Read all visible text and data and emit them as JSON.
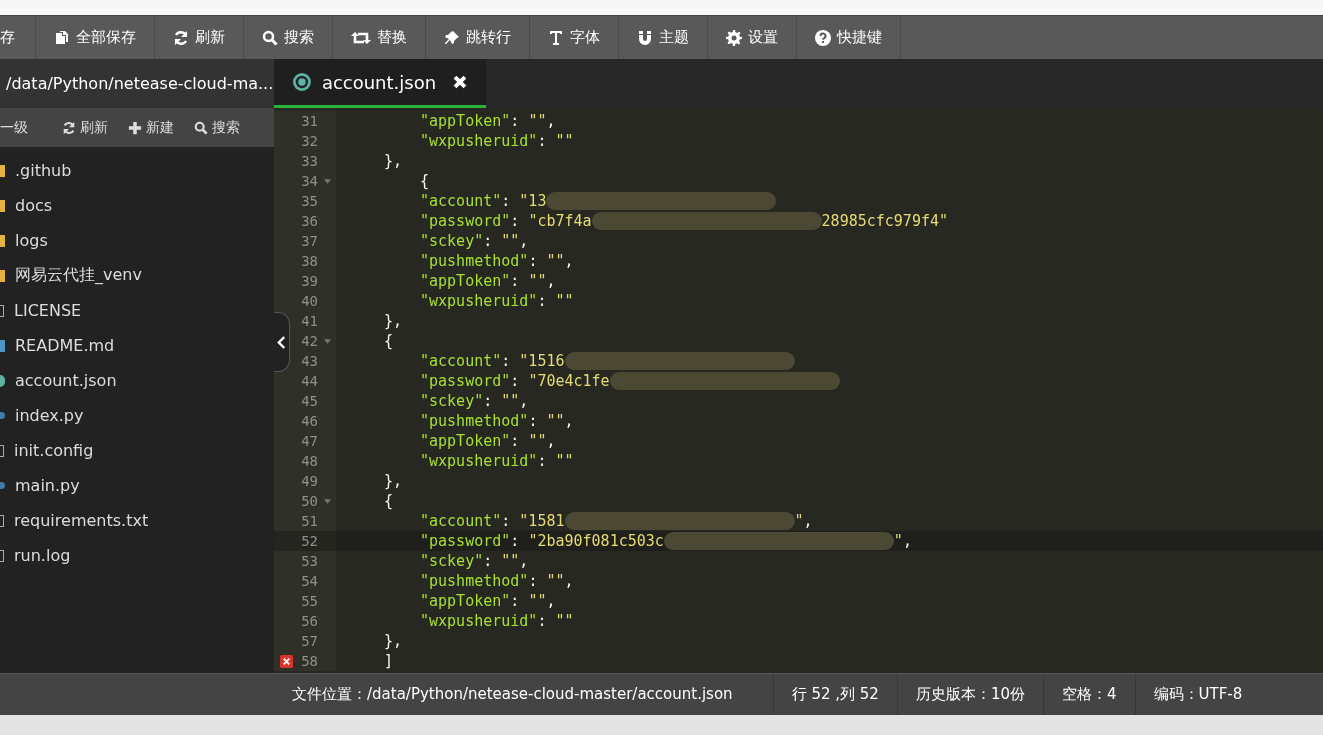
{
  "toolbar": [
    {
      "label": "存"
    },
    {
      "label": "全部保存"
    },
    {
      "label": "刷新"
    },
    {
      "label": "搜索"
    },
    {
      "label": "替换"
    },
    {
      "label": "跳转行"
    },
    {
      "label": "字体"
    },
    {
      "label": "主题"
    },
    {
      "label": "设置"
    },
    {
      "label": "快捷键"
    }
  ],
  "sidebar": {
    "path": "/data/Python/netease-cloud-ma...",
    "actions": [
      {
        "label": "一级"
      },
      {
        "label": "刷新"
      },
      {
        "label": "新建"
      },
      {
        "label": "搜索"
      }
    ],
    "items": [
      {
        "kind": "folder",
        "name": ".github"
      },
      {
        "kind": "folder",
        "name": "docs"
      },
      {
        "kind": "folder",
        "name": "logs"
      },
      {
        "kind": "folder",
        "name": "网易云代挂_venv"
      },
      {
        "kind": "file",
        "name": "LICENSE"
      },
      {
        "kind": "markdown",
        "name": "README.md"
      },
      {
        "kind": "json",
        "name": "account.json"
      },
      {
        "kind": "python",
        "name": "index.py"
      },
      {
        "kind": "file",
        "name": "init.config"
      },
      {
        "kind": "python",
        "name": "main.py"
      },
      {
        "kind": "file",
        "name": "requirements.txt"
      },
      {
        "kind": "file",
        "name": "run.log"
      }
    ]
  },
  "tabs": [
    {
      "label": "account.json",
      "selected": true
    }
  ],
  "editor": {
    "lines": [
      {
        "number": "31",
        "kind": "inner",
        "fold": false,
        "active": false,
        "error": false,
        "segments": [
          {
            "kind": "key",
            "text": "\"appToken\""
          },
          {
            "kind": "punct",
            "text": ": "
          },
          {
            "kind": "str",
            "text": "\"\""
          },
          {
            "kind": "punct",
            "text": ","
          }
        ]
      },
      {
        "number": "32",
        "kind": "inner",
        "fold": false,
        "active": false,
        "error": false,
        "segments": [
          {
            "kind": "key",
            "text": "\"wxpusheruid\""
          },
          {
            "kind": "punct",
            "text": ": "
          },
          {
            "kind": "str",
            "text": "\"\""
          }
        ]
      },
      {
        "number": "33",
        "kind": "outer",
        "fold": false,
        "active": false,
        "error": false,
        "segments": [
          {
            "kind": "punct",
            "text": "},"
          }
        ]
      },
      {
        "number": "34",
        "kind": "inner",
        "fold": true,
        "active": false,
        "error": false,
        "segments": [
          {
            "kind": "punct",
            "text": "{"
          }
        ]
      },
      {
        "number": "35",
        "kind": "inner",
        "fold": false,
        "active": false,
        "error": false,
        "segments": [
          {
            "kind": "key",
            "text": "\"account\""
          },
          {
            "kind": "punct",
            "text": ": "
          },
          {
            "kind": "str",
            "text": "\"13"
          },
          {
            "kind": "redacted"
          }
        ]
      },
      {
        "number": "36",
        "kind": "inner",
        "fold": false,
        "active": false,
        "error": false,
        "segments": [
          {
            "kind": "key",
            "text": "\"password\""
          },
          {
            "kind": "punct",
            "text": ": "
          },
          {
            "kind": "str",
            "text": "\"cb7f4a"
          },
          {
            "kind": "redacted"
          },
          {
            "kind": "str",
            "text": "28985cfc979f4\""
          }
        ]
      },
      {
        "number": "37",
        "kind": "inner",
        "fold": false,
        "active": false,
        "error": false,
        "segments": [
          {
            "kind": "key",
            "text": "\"sckey\""
          },
          {
            "kind": "punct",
            "text": ": "
          },
          {
            "kind": "str",
            "text": "\"\""
          },
          {
            "kind": "punct",
            "text": ","
          }
        ]
      },
      {
        "number": "38",
        "kind": "inner",
        "fold": false,
        "active": false,
        "error": false,
        "segments": [
          {
            "kind": "key",
            "text": "\"pushmethod\""
          },
          {
            "kind": "punct",
            "text": ": "
          },
          {
            "kind": "str",
            "text": "\"\""
          },
          {
            "kind": "punct",
            "text": ","
          }
        ]
      },
      {
        "number": "39",
        "kind": "inner",
        "fold": false,
        "active": false,
        "error": false,
        "segments": [
          {
            "kind": "key",
            "text": "\"appToken\""
          },
          {
            "kind": "punct",
            "text": ": "
          },
          {
            "kind": "str",
            "text": "\"\""
          },
          {
            "kind": "punct",
            "text": ","
          }
        ]
      },
      {
        "number": "40",
        "kind": "inner",
        "fold": false,
        "active": false,
        "error": false,
        "segments": [
          {
            "kind": "key",
            "text": "\"wxpusheruid\""
          },
          {
            "kind": "punct",
            "text": ": "
          },
          {
            "kind": "str",
            "text": "\"\""
          }
        ]
      },
      {
        "number": "41",
        "kind": "outer",
        "fold": false,
        "active": false,
        "error": false,
        "segments": [
          {
            "kind": "punct",
            "text": "},"
          }
        ]
      },
      {
        "number": "42",
        "kind": "outer",
        "fold": true,
        "active": false,
        "error": false,
        "segments": [
          {
            "kind": "punct",
            "text": "{"
          }
        ]
      },
      {
        "number": "43",
        "kind": "inner",
        "fold": false,
        "active": false,
        "error": false,
        "segments": [
          {
            "kind": "key",
            "text": "\"account\""
          },
          {
            "kind": "punct",
            "text": ": "
          },
          {
            "kind": "str",
            "text": "\"1516"
          },
          {
            "kind": "redacted"
          }
        ]
      },
      {
        "number": "44",
        "kind": "inner",
        "fold": false,
        "active": false,
        "error": false,
        "segments": [
          {
            "kind": "key",
            "text": "\"password\""
          },
          {
            "kind": "punct",
            "text": ": "
          },
          {
            "kind": "str",
            "text": "\"70e4c1fe"
          },
          {
            "kind": "redacted"
          }
        ]
      },
      {
        "number": "45",
        "kind": "inner",
        "fold": false,
        "active": false,
        "error": false,
        "segments": [
          {
            "kind": "key",
            "text": "\"sckey\""
          },
          {
            "kind": "punct",
            "text": ": "
          },
          {
            "kind": "str",
            "text": "\"\""
          },
          {
            "kind": "punct",
            "text": ","
          }
        ]
      },
      {
        "number": "46",
        "kind": "inner",
        "fold": false,
        "active": false,
        "error": false,
        "segments": [
          {
            "kind": "key",
            "text": "\"pushmethod\""
          },
          {
            "kind": "punct",
            "text": ": "
          },
          {
            "kind": "str",
            "text": "\"\""
          },
          {
            "kind": "punct",
            "text": ","
          }
        ]
      },
      {
        "number": "47",
        "kind": "inner",
        "fold": false,
        "active": false,
        "error": false,
        "segments": [
          {
            "kind": "key",
            "text": "\"appToken\""
          },
          {
            "kind": "punct",
            "text": ": "
          },
          {
            "kind": "str",
            "text": "\"\""
          },
          {
            "kind": "punct",
            "text": ","
          }
        ]
      },
      {
        "number": "48",
        "kind": "inner",
        "fold": false,
        "active": false,
        "error": false,
        "segments": [
          {
            "kind": "key",
            "text": "\"wxpusheruid\""
          },
          {
            "kind": "punct",
            "text": ": "
          },
          {
            "kind": "str",
            "text": "\"\""
          }
        ]
      },
      {
        "number": "49",
        "kind": "outer",
        "fold": false,
        "active": false,
        "error": false,
        "segments": [
          {
            "kind": "punct",
            "text": "},"
          }
        ]
      },
      {
        "number": "50",
        "kind": "outer",
        "fold": true,
        "active": false,
        "error": false,
        "segments": [
          {
            "kind": "punct",
            "text": "{"
          }
        ]
      },
      {
        "number": "51",
        "kind": "inner",
        "fold": false,
        "active": false,
        "error": false,
        "segments": [
          {
            "kind": "key",
            "text": "\"account\""
          },
          {
            "kind": "punct",
            "text": ": "
          },
          {
            "kind": "str",
            "text": "\"1581"
          },
          {
            "kind": "redacted"
          },
          {
            "kind": "str",
            "text": "\""
          },
          {
            "kind": "punct",
            "text": ","
          }
        ]
      },
      {
        "number": "52",
        "kind": "inner",
        "fold": false,
        "active": true,
        "error": false,
        "segments": [
          {
            "kind": "key",
            "text": "\"password\""
          },
          {
            "kind": "punct",
            "text": ": "
          },
          {
            "kind": "str",
            "text": "\"2ba90f081c503c"
          },
          {
            "kind": "redacted"
          },
          {
            "kind": "str",
            "text": "\""
          },
          {
            "kind": "punct",
            "text": ","
          }
        ]
      },
      {
        "number": "53",
        "kind": "inner",
        "fold": false,
        "active": false,
        "error": false,
        "segments": [
          {
            "kind": "key",
            "text": "\"sckey\""
          },
          {
            "kind": "punct",
            "text": ": "
          },
          {
            "kind": "str",
            "text": "\"\""
          },
          {
            "kind": "punct",
            "text": ","
          }
        ]
      },
      {
        "number": "54",
        "kind": "inner",
        "fold": false,
        "active": false,
        "error": false,
        "segments": [
          {
            "kind": "key",
            "text": "\"pushmethod\""
          },
          {
            "kind": "punct",
            "text": ": "
          },
          {
            "kind": "str",
            "text": "\"\""
          },
          {
            "kind": "punct",
            "text": ","
          }
        ]
      },
      {
        "number": "55",
        "kind": "inner",
        "fold": false,
        "active": false,
        "error": false,
        "segments": [
          {
            "kind": "key",
            "text": "\"appToken\""
          },
          {
            "kind": "punct",
            "text": ": "
          },
          {
            "kind": "str",
            "text": "\"\""
          },
          {
            "kind": "punct",
            "text": ","
          }
        ]
      },
      {
        "number": "56",
        "kind": "inner",
        "fold": false,
        "active": false,
        "error": false,
        "segments": [
          {
            "kind": "key",
            "text": "\"wxpusheruid\""
          },
          {
            "kind": "punct",
            "text": ": "
          },
          {
            "kind": "str",
            "text": "\"\""
          }
        ]
      },
      {
        "number": "57",
        "kind": "outer",
        "fold": false,
        "active": false,
        "error": false,
        "segments": [
          {
            "kind": "punct",
            "text": "},"
          }
        ]
      },
      {
        "number": "58",
        "kind": "outer",
        "fold": false,
        "active": false,
        "error": true,
        "segments": [
          {
            "kind": "punct",
            "text": "]"
          }
        ]
      }
    ]
  },
  "status_bar": {
    "file": "文件位置：/data/Python/netease-cloud-master/account.json",
    "items": [
      "行 52 ,列 52",
      "历史版本：10份",
      "空格：4",
      "编码：UTF-8"
    ]
  }
}
